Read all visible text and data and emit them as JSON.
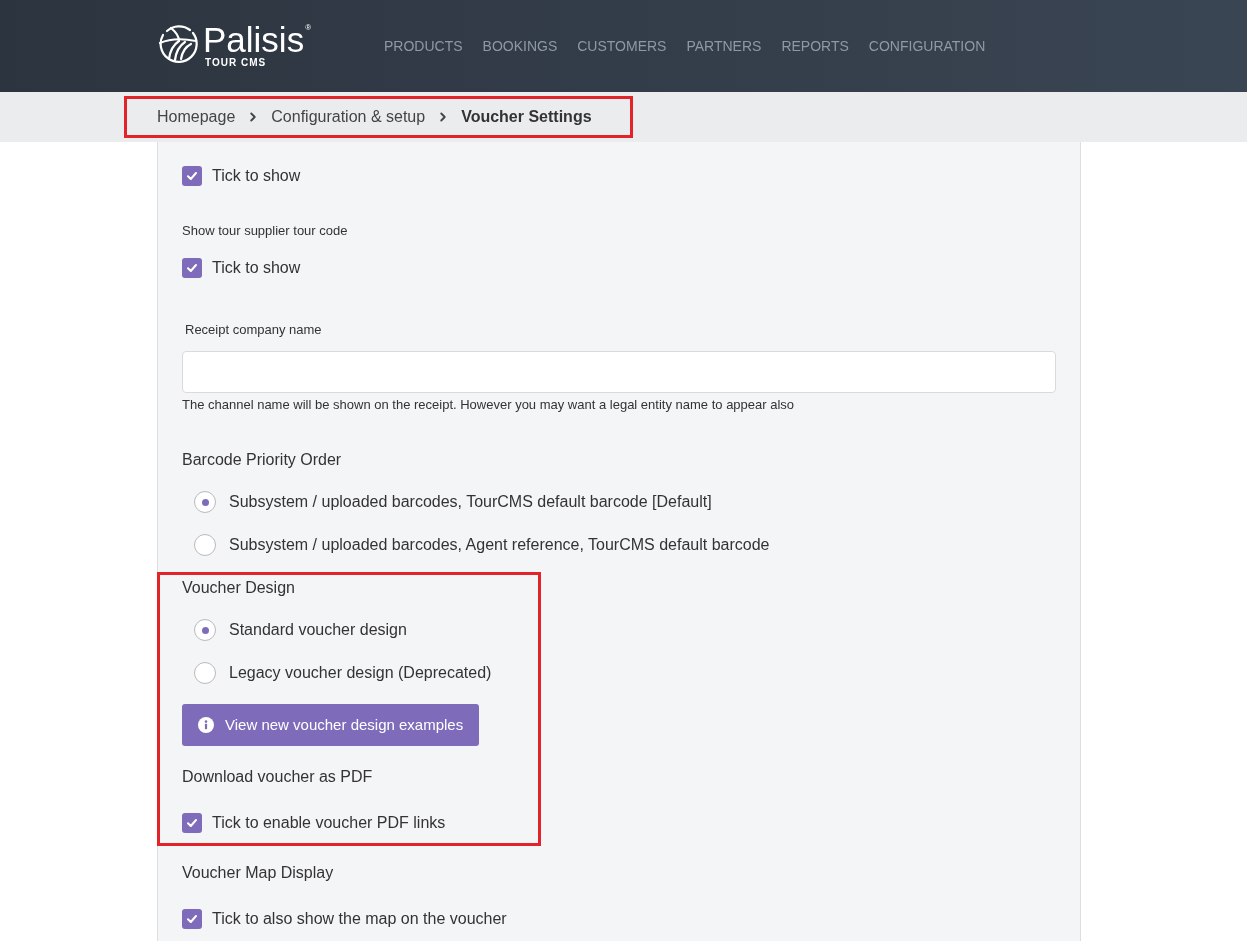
{
  "header": {
    "logo": {
      "wordmark": "Palisis",
      "registered": "®",
      "tagline": "TOUR CMS"
    },
    "nav": [
      "PRODUCTS",
      "BOOKINGS",
      "CUSTOMERS",
      "PARTNERS",
      "REPORTS",
      "CONFIGURATION"
    ]
  },
  "breadcrumb": {
    "highlighted": true,
    "items": [
      {
        "label": "Homepage",
        "current": false
      },
      {
        "label": "Configuration & setup",
        "current": false
      },
      {
        "label": "Voucher Settings",
        "current": true
      }
    ]
  },
  "groups": [
    {
      "highlighted": false,
      "blocks": [
        {
          "kind": "checkbox",
          "option": {
            "label": "Tick to show",
            "checked": true
          }
        },
        {
          "kind": "checkbox",
          "heading": {
            "kind": "caption",
            "text": "Show tour supplier tour code"
          },
          "option": {
            "label": "Tick to show",
            "checked": true
          }
        },
        {
          "kind": "text-input",
          "heading": {
            "kind": "caption",
            "text": "Receipt company name"
          },
          "help": "The channel name will be shown on the receipt. However you may want a legal entity name to appear also"
        },
        {
          "kind": "radio-group",
          "heading": {
            "kind": "title",
            "text": "Barcode Priority Order"
          },
          "options": [
            {
              "label": "Subsystem / uploaded barcodes, TourCMS default barcode [Default]",
              "selected": true
            },
            {
              "label": "Subsystem / uploaded barcodes, Agent reference, TourCMS default barcode",
              "selected": false
            }
          ]
        }
      ]
    },
    {
      "highlighted": true,
      "blocks": [
        {
          "kind": "radio-group",
          "heading": {
            "kind": "title",
            "text": "Voucher Design"
          },
          "options": [
            {
              "label": "Standard voucher design",
              "selected": true
            },
            {
              "label": "Legacy voucher design (Deprecated)",
              "selected": false
            }
          ]
        },
        {
          "kind": "button",
          "label": "View new voucher design examples"
        },
        {
          "kind": "checkbox",
          "heading": {
            "kind": "title",
            "text": "Download voucher as PDF"
          },
          "option": {
            "label": "Tick to enable voucher PDF links",
            "checked": true
          }
        }
      ]
    },
    {
      "highlighted": false,
      "blocks": [
        {
          "kind": "checkbox",
          "heading": {
            "kind": "title",
            "text": "Voucher Map Display"
          },
          "option": {
            "label": "Tick to also show the map on the voucher",
            "checked": true
          }
        }
      ]
    }
  ]
}
